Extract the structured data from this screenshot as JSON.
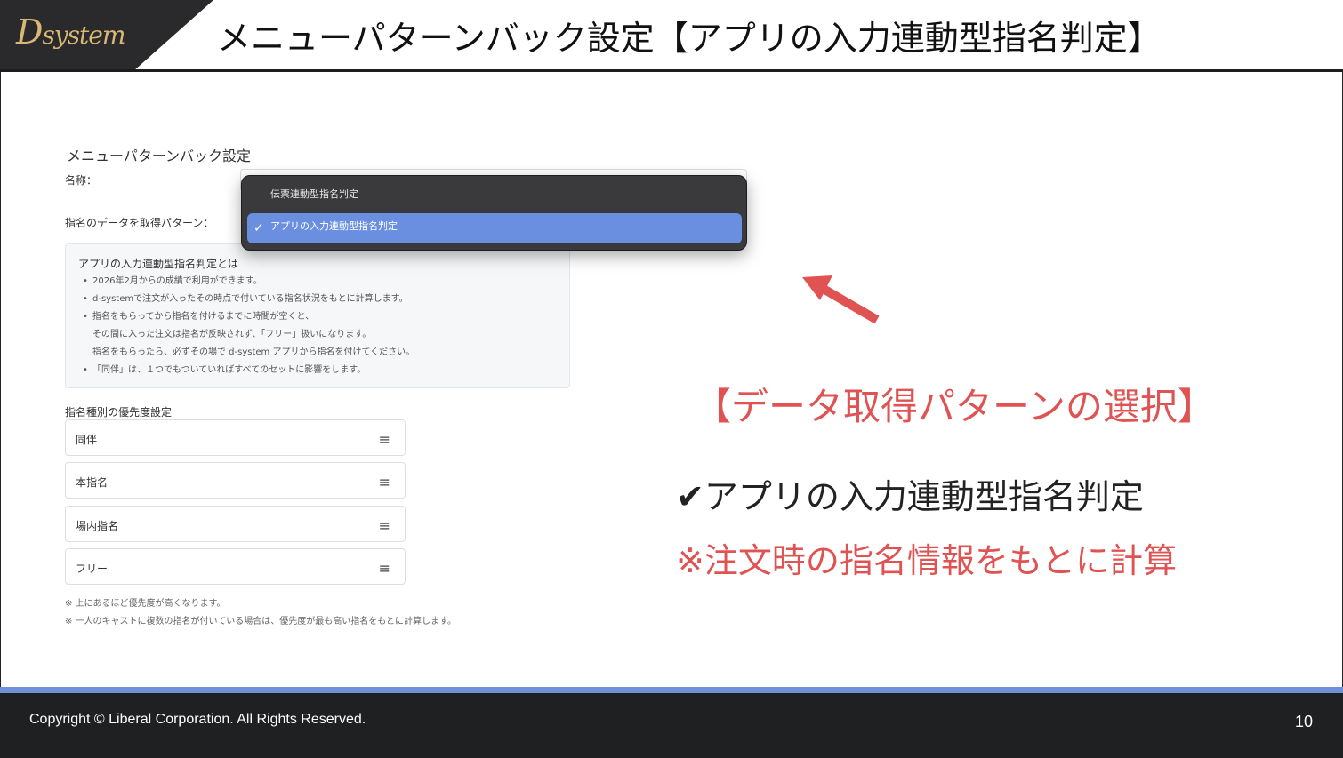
{
  "header": {
    "logo_main": "D",
    "logo_rest": "system",
    "title": "メニューパターンバック設定【アプリの入力連動型指名判定】"
  },
  "form": {
    "panel_title": "メニューパターンバック設定",
    "name_label": "名称：",
    "pattern_label": "指名のデータを取得パターン："
  },
  "dropdown": {
    "options": [
      {
        "label": "伝票連動型指名判定",
        "selected": false
      },
      {
        "label": "アプリの入力連動型指名判定",
        "selected": true
      }
    ],
    "check_mark": "✓"
  },
  "info_box": {
    "title": "アプリの入力連動型指名判定とは",
    "bullet": "•",
    "lines": [
      "2026年2月からの成績で利用ができます。",
      "d-systemで注文が入ったその時点で付いている指名状況をもとに計算します。",
      "指名をもらってから指名を付けるまでに時間が空くと、",
      "その間に入った注文は指名が反映されず、「フリー」扱いになります。",
      "指名をもらったら、必ずその場で d-system アプリから指名を付けてください。",
      "「同伴」は、１つでもついていればすべてのセットに影響をします。"
    ]
  },
  "priority": {
    "label": "指名種別の優先度設定",
    "handle_icon": "≡",
    "items": [
      "同伴",
      "本指名",
      "場内指名",
      "フリー"
    ],
    "notes": [
      "※ 上にあるほど優先度が高くなります。",
      "※ 一人のキャストに複数の指名が付いている場合は、優先度が最も高い指名をもとに計算します。"
    ]
  },
  "callouts": {
    "title": "【データ取得パターンの選択】",
    "check_line": "✔アプリの入力連動型指名判定",
    "note_line": "※注文時の指名情報をもとに計算"
  },
  "colors": {
    "accent_red": "#e05353",
    "footer_bar": "#6f8fd8",
    "dropdown_selected": "#6a8fe0"
  },
  "footer": {
    "copyright": "Copyright ©  Liberal Corporation. All Rights Reserved.",
    "page_number": "10"
  }
}
